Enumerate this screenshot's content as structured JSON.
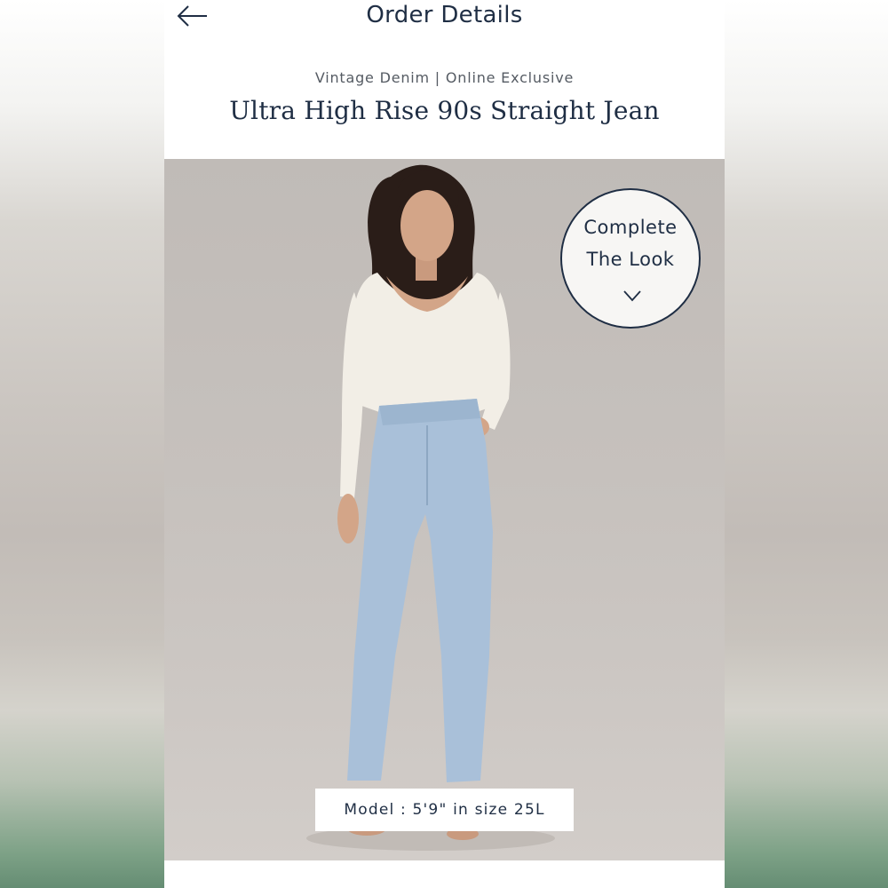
{
  "header": {
    "title": "Order Details",
    "back_icon": "arrow-left-icon"
  },
  "product": {
    "subtitle": "Vintage Denim | Online Exclusive",
    "name": "Ultra High Rise 90s Straight Jean"
  },
  "complete_look": {
    "line1": "Complete",
    "line2": "The Look",
    "icon": "chevron-down-icon"
  },
  "image": {
    "model_caption": "Model : 5'9\" in size 25L"
  },
  "colors": {
    "text_primary": "#1f2e44",
    "text_secondary": "#555b63",
    "photo_background": "#c6c1bd"
  }
}
